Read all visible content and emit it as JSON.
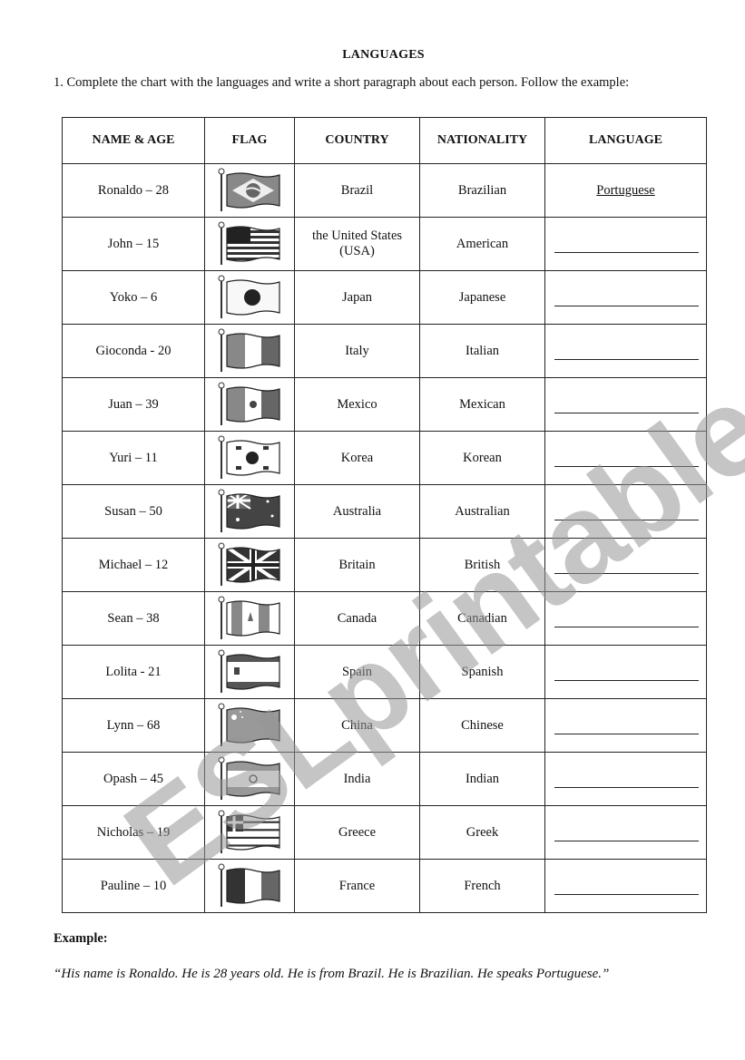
{
  "title": "LANGUAGES",
  "instruction": "1. Complete the chart with the languages and write a short paragraph about each person. Follow the example:",
  "table": {
    "headers": [
      "NAME & AGE",
      "FLAG",
      "COUNTRY",
      "NATIONALITY",
      "LANGUAGE"
    ],
    "rows": [
      {
        "name": "Ronaldo – 28",
        "flag": "brazil-flag-icon",
        "country": "Brazil",
        "nationality": "Brazilian",
        "language": "Portuguese"
      },
      {
        "name": "John – 15",
        "flag": "usa-flag-icon",
        "country": "the United States (USA)",
        "nationality": "American",
        "language": ""
      },
      {
        "name": "Yoko – 6",
        "flag": "japan-flag-icon",
        "country": "Japan",
        "nationality": "Japanese",
        "language": ""
      },
      {
        "name": "Gioconda - 20",
        "flag": "italy-flag-icon",
        "country": "Italy",
        "nationality": "Italian",
        "language": ""
      },
      {
        "name": "Juan – 39",
        "flag": "mexico-flag-icon",
        "country": "Mexico",
        "nationality": "Mexican",
        "language": ""
      },
      {
        "name": "Yuri – 11",
        "flag": "korea-flag-icon",
        "country": "Korea",
        "nationality": "Korean",
        "language": ""
      },
      {
        "name": "Susan – 50",
        "flag": "australia-flag-icon",
        "country": "Australia",
        "nationality": "Australian",
        "language": ""
      },
      {
        "name": "Michael – 12",
        "flag": "britain-flag-icon",
        "country": "Britain",
        "nationality": "British",
        "language": ""
      },
      {
        "name": "Sean – 38",
        "flag": "canada-flag-icon",
        "country": "Canada",
        "nationality": "Canadian",
        "language": ""
      },
      {
        "name": "Lolita - 21",
        "flag": "spain-flag-icon",
        "country": "Spain",
        "nationality": "Spanish",
        "language": ""
      },
      {
        "name": "Lynn – 68",
        "flag": "china-flag-icon",
        "country": "China",
        "nationality": "Chinese",
        "language": ""
      },
      {
        "name": "Opash – 45",
        "flag": "india-flag-icon",
        "country": "India",
        "nationality": "Indian",
        "language": ""
      },
      {
        "name": "Nicholas – 19",
        "flag": "greece-flag-icon",
        "country": "Greece",
        "nationality": "Greek",
        "language": ""
      },
      {
        "name": "Pauline – 10",
        "flag": "france-flag-icon",
        "country": "France",
        "nationality": "French",
        "language": ""
      }
    ]
  },
  "example": {
    "label": "Example:",
    "text": "“His name is Ronaldo. He is 28 years old. He is from Brazil. He is Brazilian. He speaks Portuguese.”"
  },
  "watermark": "ESLprintables.com"
}
